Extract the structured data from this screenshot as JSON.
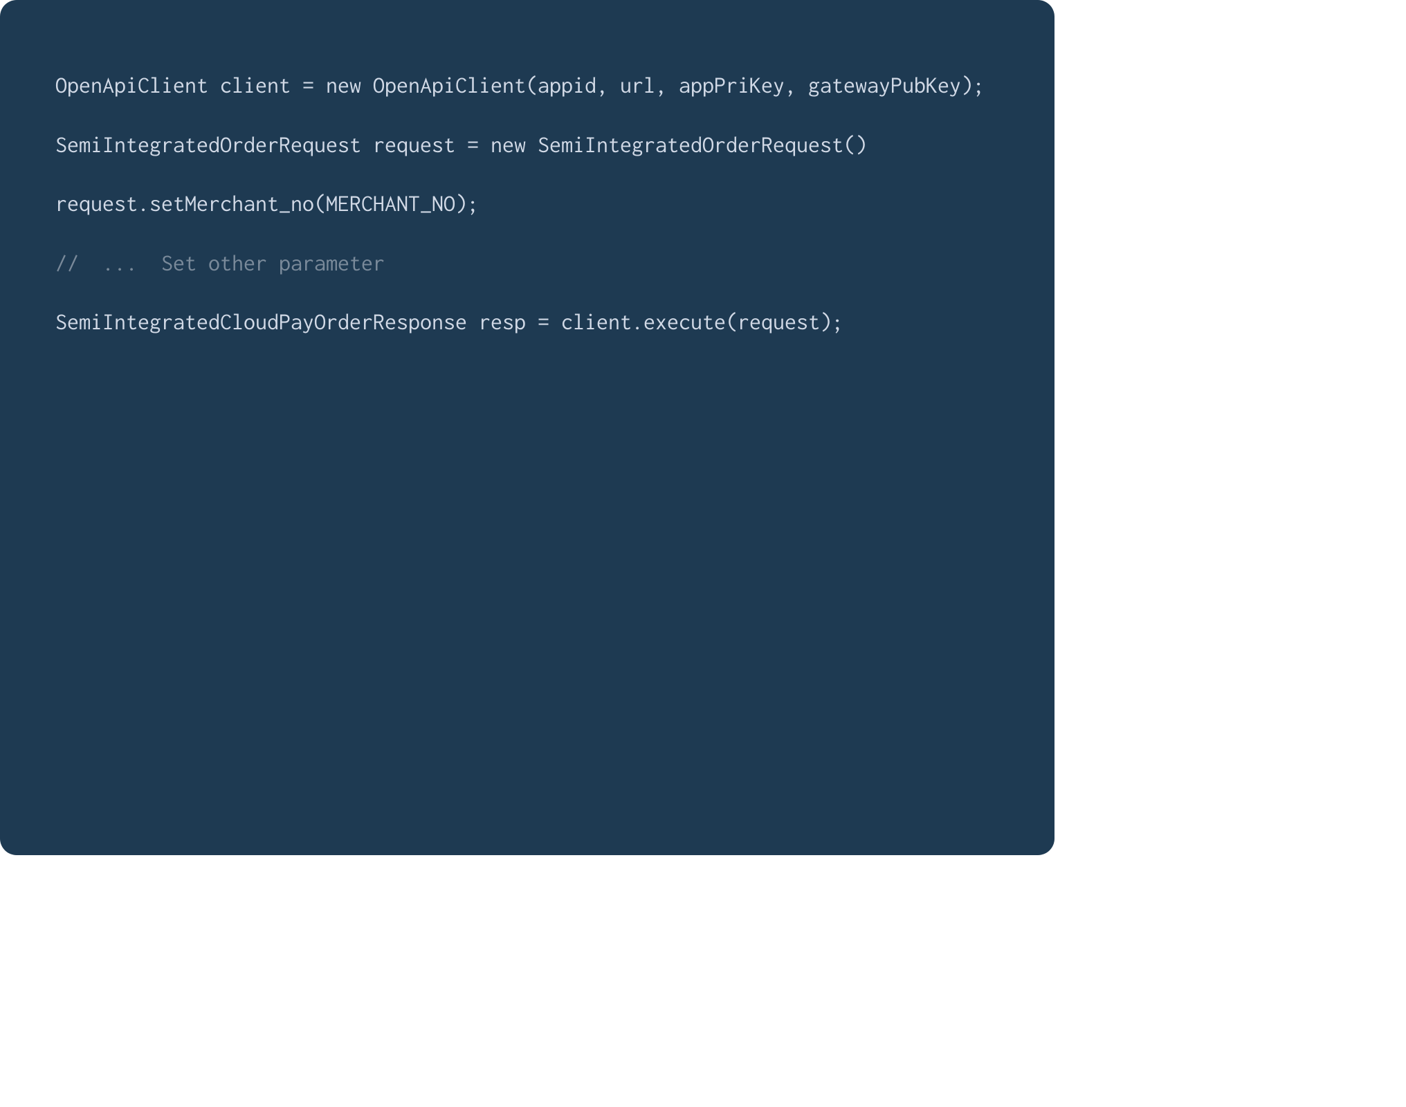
{
  "code": {
    "line1": "OpenApiClient client = new OpenApiClient(appid, url, appPriKey, gatewayPubKey);",
    "line2": "SemiIntegratedOrderRequest request = new SemiIntegratedOrderRequest()",
    "line3": "request.setMerchant_no(MERCHANT_NO);",
    "comment": "//  ...  Set other parameter",
    "line4": "SemiIntegratedCloudPayOrderResponse resp = client.execute(request);"
  },
  "colors": {
    "background": "#1e3a52",
    "text": "#d1d9e6",
    "comment": "#7a8a9a"
  }
}
